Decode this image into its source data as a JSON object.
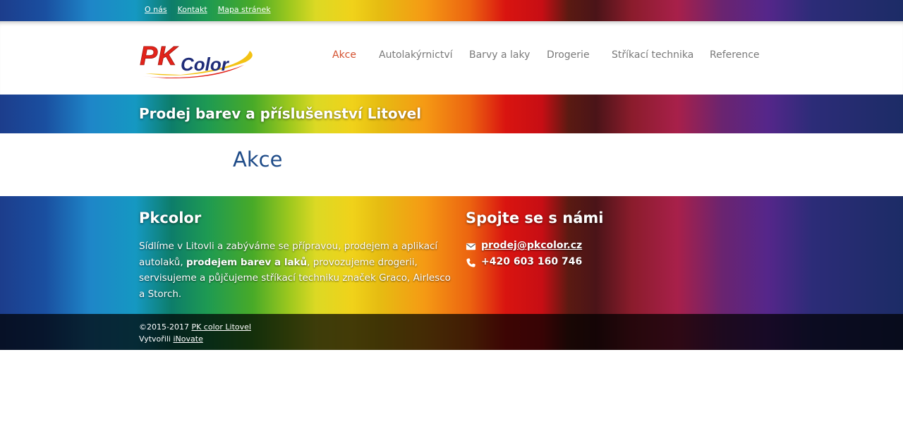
{
  "top_links": {
    "o_nas": "O nás",
    "kontakt": "Kontakt",
    "mapa": "Mapa stránek"
  },
  "logo": {
    "pk": "PK",
    "color": "Color"
  },
  "nav": {
    "akce": "Akce",
    "autolakyrnictvi": "Autolakýrnictví",
    "barvy": "Barvy a laky",
    "drogerie": "Drogerie",
    "strikaci": "Stříkací technika",
    "reference": "Reference"
  },
  "banner": {
    "title": "Prodej barev a příslušenství Litovel"
  },
  "content": {
    "heading": "Akce"
  },
  "footer": {
    "about_title": "Pkcolor",
    "about_text_1": "Sídlíme v Litovli a zabýváme se přípravou, prodejem a aplikací autolaků, ",
    "about_text_bold": "prodejem barev a laků",
    "about_text_2": ", provozujeme drogerii, servisujeme a půjčujeme stříkací techniku značek Graco, Airlesco a Storch.",
    "contact_title": "Spojte se s námi",
    "email": "prodej@pkcolor.cz",
    "phone": "+420 603 160 746"
  },
  "copyright": {
    "prefix": "©2015-2017 ",
    "company_link": "PK color Litovel",
    "created_prefix": "Vytvořili ",
    "creator_link": "iNovate"
  },
  "colors": {
    "nav_active": "#d4502e",
    "heading_blue": "#1e4b88",
    "logo_red": "#e2231a",
    "logo_blue": "#1f2c78"
  }
}
